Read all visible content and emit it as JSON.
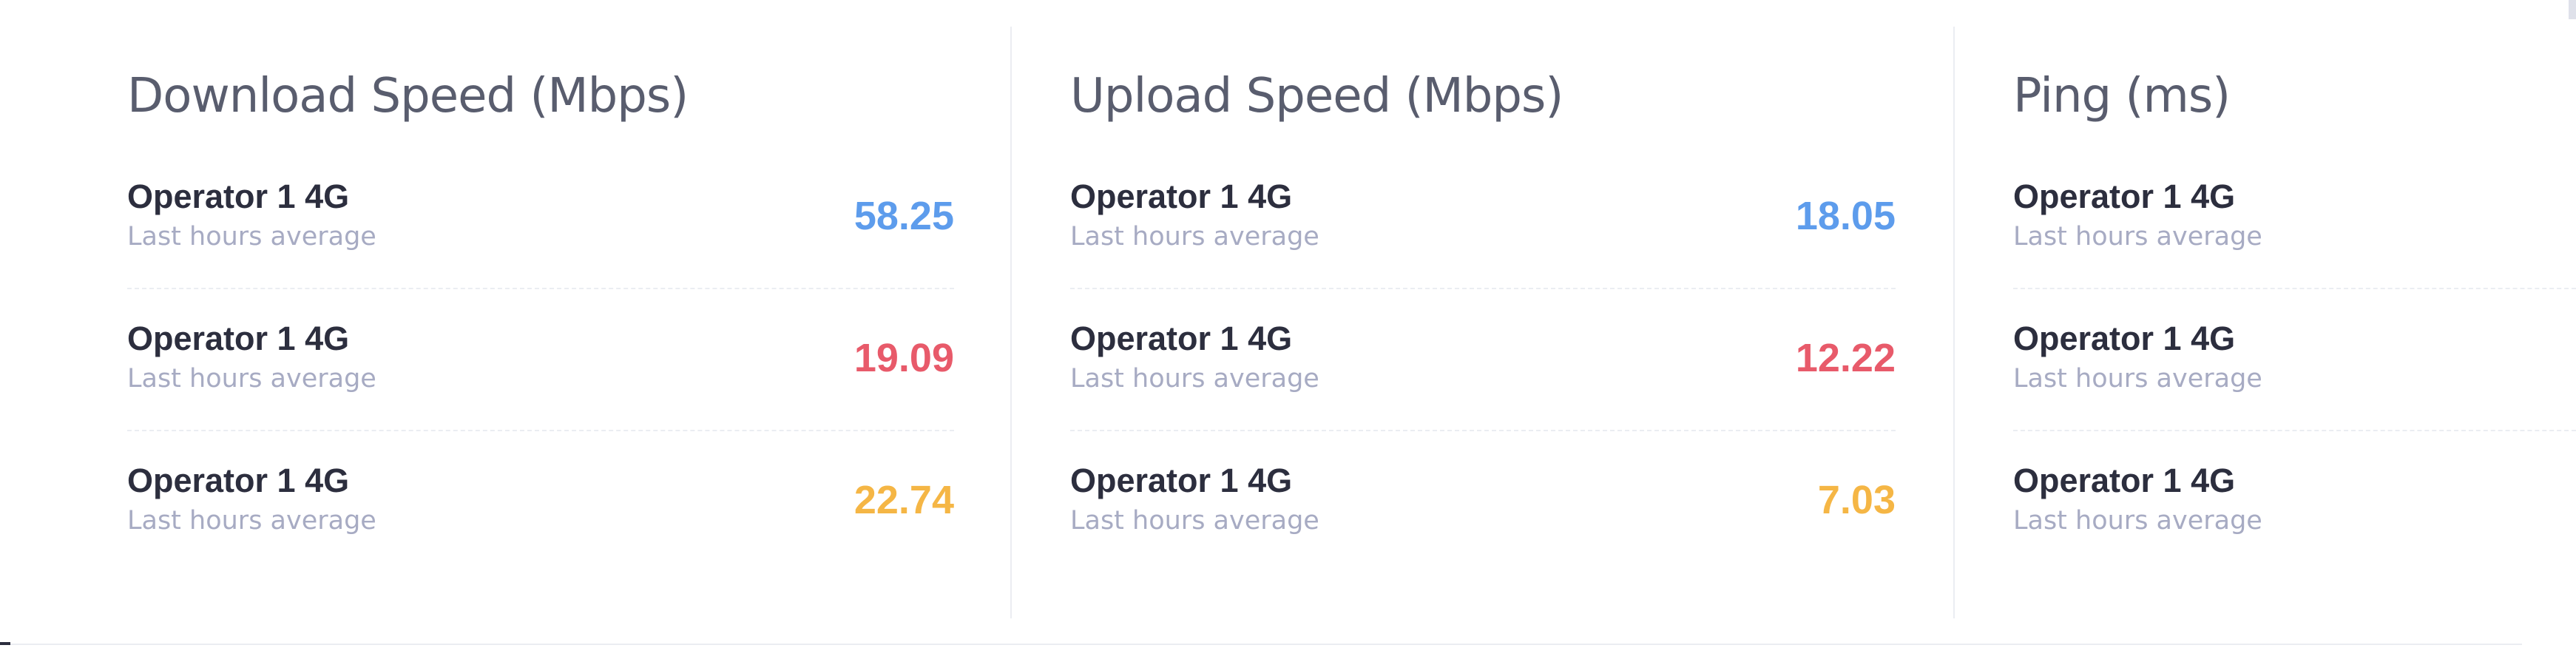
{
  "colors": {
    "blue": "#5d9cec",
    "red": "#e85a6a",
    "yellow": "#f5b645"
  },
  "panels": [
    {
      "title": "Download Speed (Mbps)",
      "rows": [
        {
          "name": "Operator 1 4G",
          "desc": "Last hours average",
          "value": "58.25",
          "color": "blue"
        },
        {
          "name": "Operator 1 4G",
          "desc": "Last hours average",
          "value": "19.09",
          "color": "red"
        },
        {
          "name": "Operator 1 4G",
          "desc": "Last hours average",
          "value": "22.74",
          "color": "yellow"
        }
      ]
    },
    {
      "title": "Upload Speed (Mbps)",
      "rows": [
        {
          "name": "Operator 1 4G",
          "desc": "Last hours average",
          "value": "18.05",
          "color": "blue"
        },
        {
          "name": "Operator 1 4G",
          "desc": "Last hours average",
          "value": "12.22",
          "color": "red"
        },
        {
          "name": "Operator 1 4G",
          "desc": "Last hours average",
          "value": "7.03",
          "color": "yellow"
        }
      ]
    },
    {
      "title": "Ping (ms)",
      "rows": [
        {
          "name": "Operator 1 4G",
          "desc": "Last hours average",
          "color": "blue"
        },
        {
          "name": "Operator 1 4G",
          "desc": "Last hours average",
          "color": "red"
        },
        {
          "name": "Operator 1 4G",
          "desc": "Last hours average",
          "color": "yellow"
        }
      ]
    }
  ]
}
